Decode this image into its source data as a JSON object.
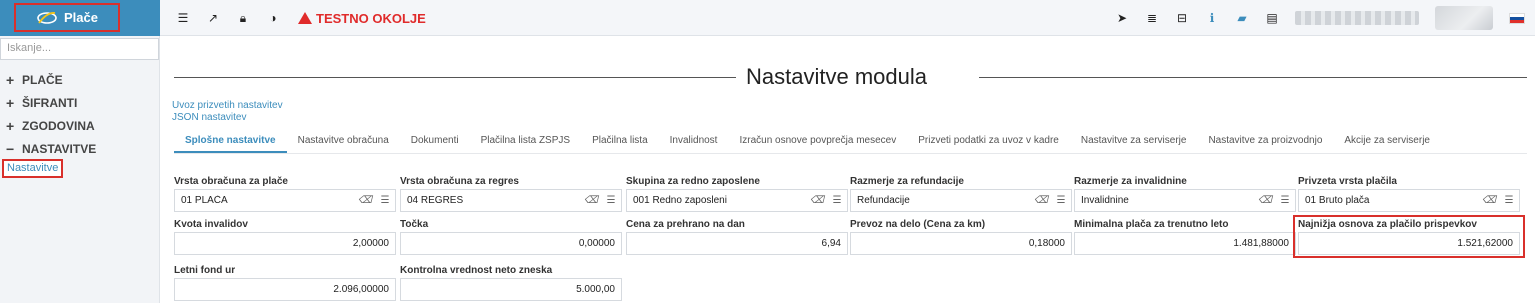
{
  "app": {
    "title": "Plače"
  },
  "toolbar": {
    "warning": "TESTNO OKOLJE"
  },
  "sidebar": {
    "search_placeholder": "Iskanje...",
    "items": [
      {
        "sign": "+",
        "label": "PLAČE"
      },
      {
        "sign": "+",
        "label": "ŠIFRANTI"
      },
      {
        "sign": "+",
        "label": "ZGODOVINA"
      },
      {
        "sign": "−",
        "label": "NASTAVITVE"
      }
    ],
    "sub_item": "Nastavitve"
  },
  "main": {
    "title": "Nastavitve modula",
    "links": [
      "Uvoz prizvetih nastavitev",
      "JSON nastavitev"
    ],
    "tabs": [
      "Splošne nastavitve",
      "Nastavitve obračuna",
      "Dokumenti",
      "Plačilna lista ZSPJS",
      "Plačilna lista",
      "Invalidnost",
      "Izračun osnove povprečja mesecev",
      "Prizveti podatki za uvoz v kadre",
      "Nastavitve za serviserje",
      "Nastavitve za proizvodnjo",
      "Akcije za serviserje"
    ],
    "active_tab": 0,
    "row1": [
      {
        "label": "Vrsta obračuna za plače",
        "value": "01 PLAČA"
      },
      {
        "label": "Vrsta obračuna za regres",
        "value": "04 REGRES"
      },
      {
        "label": "Skupina za redno zaposlene",
        "value": "001 Redno zaposleni"
      },
      {
        "label": "Razmerje za refundacije",
        "value": "Refundacije"
      },
      {
        "label": "Razmerje za invalidnine",
        "value": "Invalidnine"
      },
      {
        "label": "Privzeta vrsta plačila",
        "value": "01 Bruto plača"
      }
    ],
    "row2": [
      {
        "label": "Kvota invalidov",
        "value": "2,00000"
      },
      {
        "label": "Točka",
        "value": "0,00000"
      },
      {
        "label": "Cena za prehrano na dan",
        "value": "6,94"
      },
      {
        "label": "Prevoz na delo (Cena za km)",
        "value": "0,18000"
      },
      {
        "label": "Minimalna plača za trenutno leto",
        "value": "1.481,88000"
      },
      {
        "label": "Najnižja osnova za plačilo prispevkov",
        "value": "1.521,62000"
      }
    ],
    "row3": [
      {
        "label": "Letni fond ur",
        "value": "2.096,00000"
      },
      {
        "label": "Kontrolna vrednost neto zneska",
        "value": "5.000,00"
      }
    ]
  },
  "colors": {
    "accent": "#3c8dbc",
    "highlight": "#d9302b",
    "warning": "#e02b2b"
  }
}
